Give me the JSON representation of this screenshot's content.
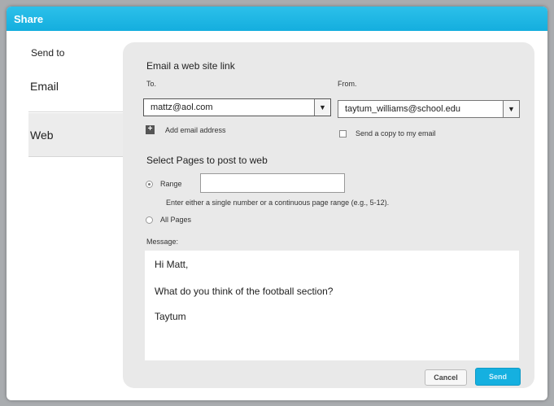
{
  "dialog": {
    "title": "Share"
  },
  "sidebar": {
    "label": "Send to",
    "items": [
      {
        "label": "Email"
      },
      {
        "label": "Web"
      }
    ]
  },
  "email": {
    "heading": "Email a web site link",
    "to_label": "To.",
    "to_value": "mattz@aol.com",
    "from_label": "From.",
    "from_value": "taytum_williams@school.edu",
    "add_address_label": "Add email address",
    "copy_label": "Send a copy to my email"
  },
  "pages": {
    "heading": "Select Pages to post to web",
    "range_label": "Range",
    "range_value": "",
    "range_hint": "Enter either a single number or a continuous page range (e.g., 5-12).",
    "all_label": "All Pages",
    "selected": "Range"
  },
  "message": {
    "label": "Message:",
    "lines": [
      "Hi Matt,",
      "What do you think of the football section?",
      "Taytum"
    ]
  },
  "buttons": {
    "cancel": "Cancel",
    "send": "Send"
  },
  "colors": {
    "accent": "#15b0e0",
    "panel": "#e9e9e9"
  }
}
